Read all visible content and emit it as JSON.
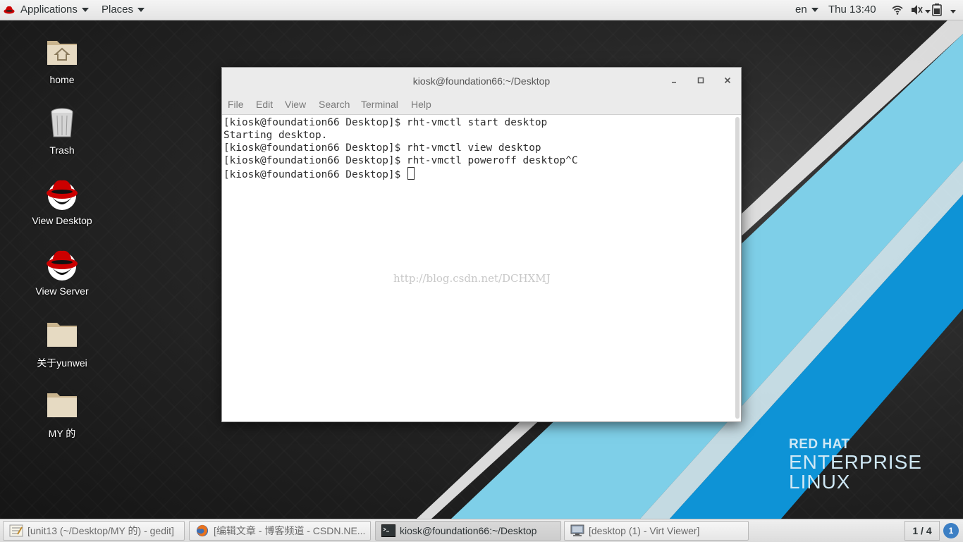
{
  "topbar": {
    "applications": "Applications",
    "places": "Places",
    "lang": "en",
    "clock": "Thu 13:40",
    "tray_icons": [
      "wifi-icon",
      "volume-icon",
      "battery-icon"
    ]
  },
  "desktop_icons": [
    {
      "label": "home",
      "icon": "home-folder-icon"
    },
    {
      "label": "Trash",
      "icon": "trash-icon"
    },
    {
      "label": "View Desktop",
      "icon": "redhat-icon"
    },
    {
      "label": "View Server",
      "icon": "redhat-icon"
    },
    {
      "label": "关于yunwei",
      "icon": "folder-icon"
    },
    {
      "label": "MY 的",
      "icon": "folder-icon"
    }
  ],
  "terminal": {
    "title": "kiosk@foundation66:~/Desktop",
    "menu": [
      "File",
      "Edit",
      "View",
      "Search",
      "Terminal",
      "Help"
    ],
    "lines": [
      "[kiosk@foundation66 Desktop]$ rht-vmctl start desktop",
      "Starting desktop.",
      "[kiosk@foundation66 Desktop]$ rht-vmctl view desktop",
      "[kiosk@foundation66 Desktop]$ rht-vmctl poweroff desktop^C",
      "[kiosk@foundation66 Desktop]$ "
    ],
    "watermark": "http://blog.csdn.net/DCHXMJ"
  },
  "brand": {
    "line1": "RED HAT",
    "line2": "ENTERPRISE",
    "line3": "LINUX"
  },
  "taskbar": {
    "tasks": [
      {
        "label": "[unit13 (~/Desktop/MY 的) - gedit]",
        "icon": "gedit-icon"
      },
      {
        "label": "[编辑文章 - 博客频道 - CSDN.NE...",
        "icon": "firefox-icon"
      },
      {
        "label": "kiosk@foundation66:~/Desktop",
        "icon": "terminal-icon"
      },
      {
        "label": "[desktop (1) - Virt Viewer]",
        "icon": "virt-viewer-icon"
      }
    ],
    "workspace": "1 / 4",
    "notifications": "1"
  },
  "colors": {
    "stripe_light": "#7ecfe8",
    "stripe_dark": "#0e93d6",
    "redhat": "#cc0000"
  }
}
